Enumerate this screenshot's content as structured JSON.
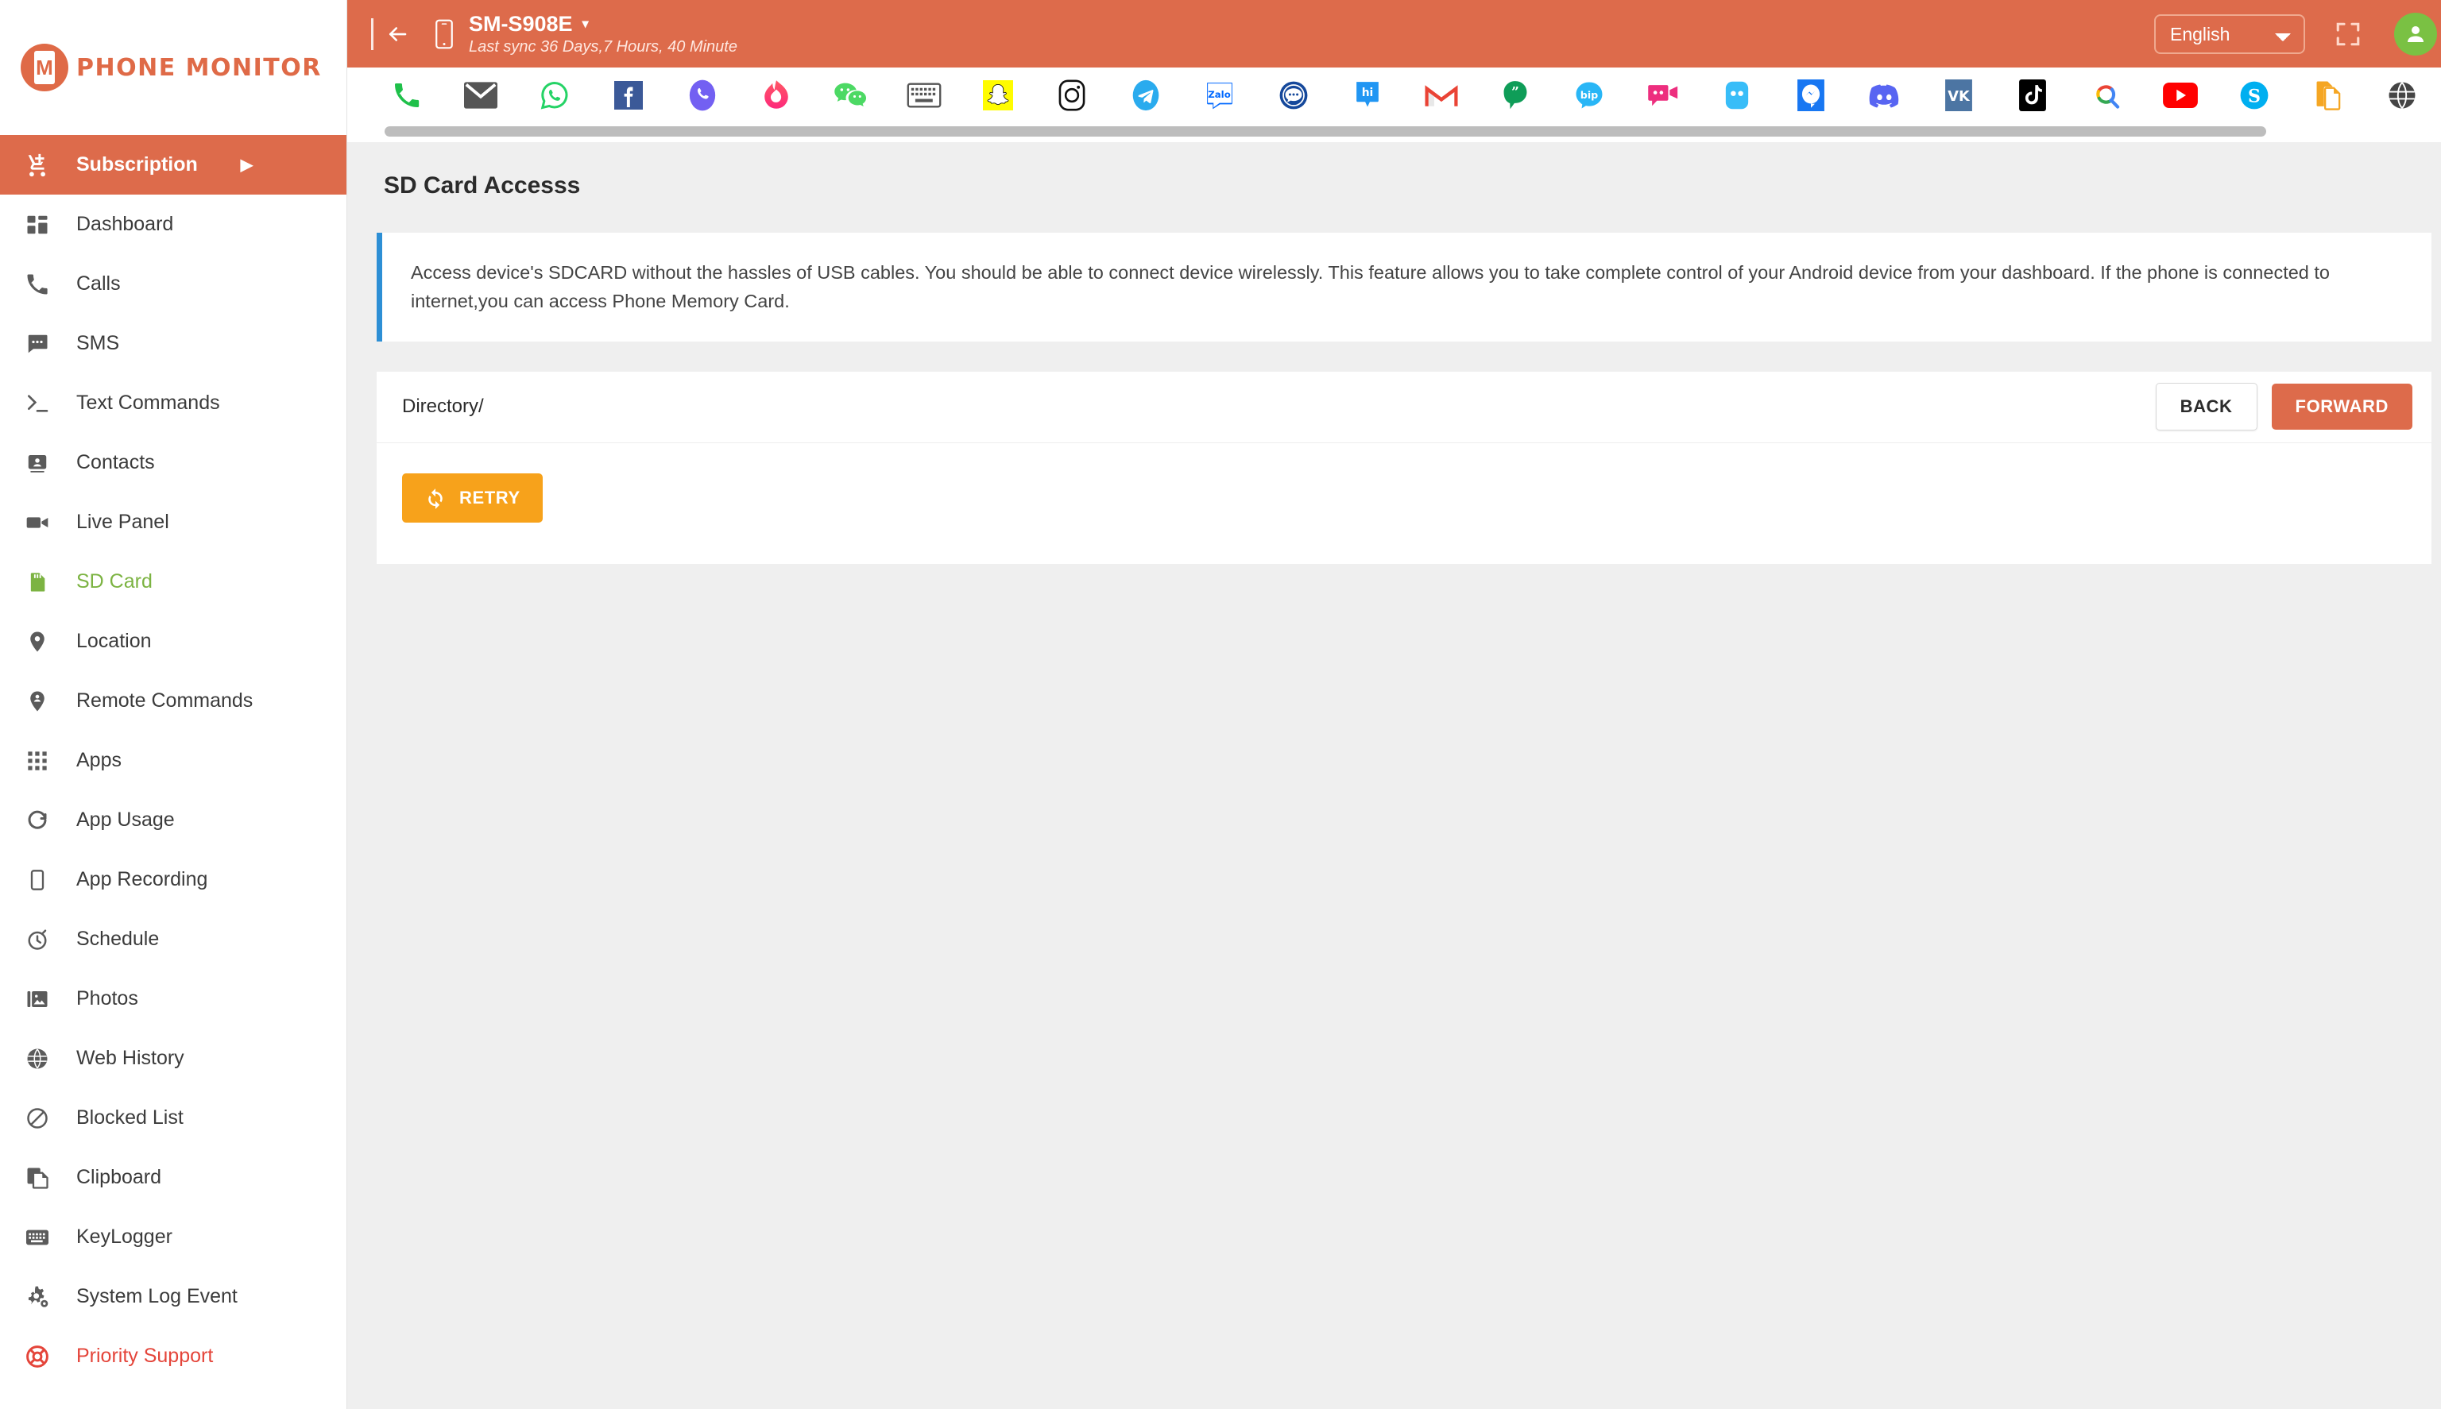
{
  "brand": {
    "name": "PHONE MONITOR",
    "mark_letter": "M"
  },
  "sidebar": {
    "items": [
      {
        "label": "Subscription",
        "icon": "cart-plus-icon",
        "state": "active",
        "caret": "▶"
      },
      {
        "label": "Dashboard",
        "icon": "dashboard-grid-icon",
        "state": "normal"
      },
      {
        "label": "Calls",
        "icon": "phone-icon",
        "state": "normal"
      },
      {
        "label": "SMS",
        "icon": "sms-bubble-icon",
        "state": "normal"
      },
      {
        "label": "Text Commands",
        "icon": "terminal-prompt-icon",
        "state": "normal"
      },
      {
        "label": "Contacts",
        "icon": "contact-card-icon",
        "state": "normal"
      },
      {
        "label": "Live Panel",
        "icon": "video-camera-icon",
        "state": "normal"
      },
      {
        "label": "SD Card",
        "icon": "sd-card-icon",
        "state": "selected"
      },
      {
        "label": "Location",
        "icon": "map-pin-icon",
        "state": "normal"
      },
      {
        "label": "Remote Commands",
        "icon": "map-pin-person-icon",
        "state": "normal"
      },
      {
        "label": "Apps",
        "icon": "apps-grid-icon",
        "state": "normal"
      },
      {
        "label": "App Usage",
        "icon": "usage-ring-icon",
        "state": "normal"
      },
      {
        "label": "App Recording",
        "icon": "phone-outline-icon",
        "state": "normal"
      },
      {
        "label": "Schedule",
        "icon": "stopwatch-icon",
        "state": "normal"
      },
      {
        "label": "Photos",
        "icon": "photos-icon",
        "state": "normal"
      },
      {
        "label": "Web History",
        "icon": "globe-icon",
        "state": "normal"
      },
      {
        "label": "Blocked List",
        "icon": "block-circle-icon",
        "state": "normal"
      },
      {
        "label": "Clipboard",
        "icon": "clipboard-copy-icon",
        "state": "normal"
      },
      {
        "label": "KeyLogger",
        "icon": "keyboard-icon",
        "state": "normal"
      },
      {
        "label": "System Log Event",
        "icon": "gears-icon",
        "state": "normal"
      },
      {
        "label": "Priority Support",
        "icon": "lifebuoy-icon",
        "state": "support"
      }
    ]
  },
  "topbar": {
    "back_icon": "back-to-list-icon",
    "device_icon": "mobile-phone-icon",
    "device_name": "SM-S908E",
    "device_caret": "▾",
    "last_sync": "Last sync 36 Days,7 Hours, 40 Minute",
    "language": "English",
    "language_options": [
      "English"
    ],
    "fullscreen_icon": "fullscreen-icon",
    "avatar_icon": "user-avatar-icon",
    "accent_color": "#dd6b4b",
    "avatar_color": "#7ac143"
  },
  "app_strip": {
    "icons": [
      {
        "name": "phone-call-icon",
        "title": "Calls"
      },
      {
        "name": "email-icon",
        "title": "Email"
      },
      {
        "name": "whatsapp-icon",
        "title": "WhatsApp"
      },
      {
        "name": "facebook-icon",
        "title": "Facebook"
      },
      {
        "name": "viber-icon",
        "title": "Viber"
      },
      {
        "name": "tinder-icon",
        "title": "Tinder"
      },
      {
        "name": "wechat-icon",
        "title": "WeChat"
      },
      {
        "name": "keyboard-icon",
        "title": "Keylogger"
      },
      {
        "name": "snapchat-icon",
        "title": "Snapchat"
      },
      {
        "name": "instagram-icon",
        "title": "Instagram"
      },
      {
        "name": "telegram-icon",
        "title": "Telegram"
      },
      {
        "name": "zalo-icon",
        "title": "Zalo"
      },
      {
        "name": "imo-icon",
        "title": "imo"
      },
      {
        "name": "hike-icon",
        "title": "Hike"
      },
      {
        "name": "gmail-icon",
        "title": "Gmail"
      },
      {
        "name": "hangouts-icon",
        "title": "Hangouts"
      },
      {
        "name": "bip-icon",
        "title": "BiP"
      },
      {
        "name": "totok-icon",
        "title": "ToTok"
      },
      {
        "name": "tango-icon",
        "title": "Tango"
      },
      {
        "name": "messenger-icon",
        "title": "Messenger"
      },
      {
        "name": "discord-icon",
        "title": "Discord"
      },
      {
        "name": "vk-icon",
        "title": "VK"
      },
      {
        "name": "tiktok-icon",
        "title": "TikTok"
      },
      {
        "name": "google-search-icon",
        "title": "Google"
      },
      {
        "name": "youtube-icon",
        "title": "YouTube"
      },
      {
        "name": "skype-icon",
        "title": "Skype"
      },
      {
        "name": "sdcard-file-icon",
        "title": "SD Card"
      },
      {
        "name": "web-globe-icon",
        "title": "Web"
      }
    ]
  },
  "content": {
    "page_title": "SD Card Accesss",
    "info_text": "Access device's SDCARD without the hassles of USB cables. You should be able to connect device wirelessly. This feature allows you to take complete control of your Android device from your dashboard. If the phone is connected to internet,you can access Phone Memory Card.",
    "info_accent_color": "#2d8fd5",
    "directory_label": "Directory/",
    "back_label": "BACK",
    "forward_label": "FORWARD",
    "retry_label": "RETRY",
    "retry_icon": "refresh-icon",
    "retry_color": "#f7a21b"
  }
}
